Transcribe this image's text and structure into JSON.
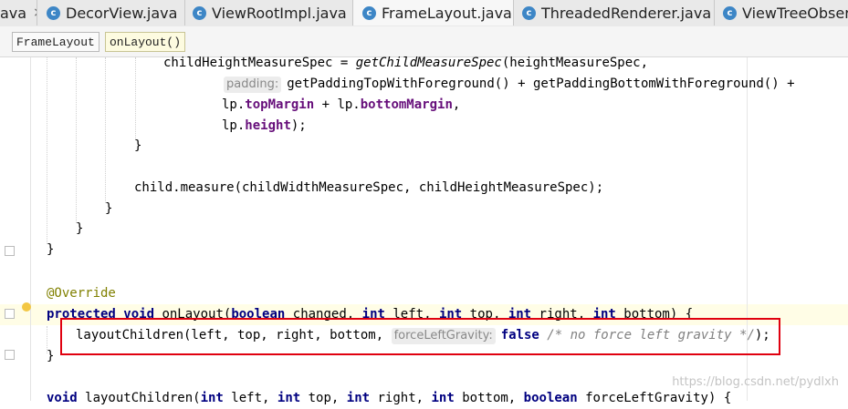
{
  "tabs": [
    {
      "label": "ava",
      "active": false,
      "icon": "none"
    },
    {
      "label": "DecorView.java",
      "active": false,
      "icon": "class-icon"
    },
    {
      "label": "ViewRootImpl.java",
      "active": false,
      "icon": "class-icon"
    },
    {
      "label": "FrameLayout.java",
      "active": true,
      "icon": "class-icon"
    },
    {
      "label": "ThreadedRenderer.java",
      "active": false,
      "icon": "class-icon"
    },
    {
      "label": "ViewTreeObserv",
      "active": false,
      "icon": "class-icon"
    }
  ],
  "class_icon_letter": "c",
  "close_glyph": "×",
  "breadcrumbs": {
    "class": "FrameLayout",
    "method": "onLayout()"
  },
  "code": {
    "l1": {
      "a": "childHeightMeasureSpec = ",
      "b": "getChildMeasureSpec",
      "c": "(heightMeasureSpec,"
    },
    "l2": {
      "hint": "padding:",
      "a": "getPaddingTopWithForeground() + getPaddingBottomWithForeground() +"
    },
    "l3": {
      "a": "lp.",
      "b": "topMargin",
      "c": " + lp.",
      "d": "bottomMargin",
      "e": ","
    },
    "l4": {
      "a": "lp.",
      "b": "height",
      "c": ");"
    },
    "l5": "}",
    "l6": "child.measure(childWidthMeasureSpec, childHeightMeasureSpec);",
    "l7": "}",
    "l8": "}",
    "l9": "}",
    "l10": "@Override",
    "l11": {
      "kw1": "protected void",
      "name": "onLayout",
      "p1": "(",
      "kw2": "boolean",
      "p2": " changed, ",
      "kw3": "int",
      "p3": " left, ",
      "kw4": "int",
      "p4": " top, ",
      "kw5": "int",
      "p5": " right, ",
      "kw6": "int",
      "p6": " bottom) {"
    },
    "l12": {
      "a": "layoutChildren(left, top, right, bottom,",
      "hint": "forceLeftGravity:",
      "kw": "false",
      "cmt": "/* no force left gravity */",
      "end": ");"
    },
    "l13": "}",
    "l14": {
      "kw1": "void",
      "a": " layoutChildren(",
      "kw2": "int",
      "b": " left, ",
      "kw3": "int",
      "c": " top, ",
      "kw4": "int",
      "d": " right, ",
      "kw5": "int",
      "e": " bottom, ",
      "kw6": "boolean",
      "f": " forceLeftGravity) {"
    }
  },
  "watermark": "https://blog.csdn.net/pydlxh",
  "colors": {
    "keyword": "#000080",
    "field": "#660e7a",
    "annotation": "#808000",
    "highlight_box": "#e0000f",
    "caret_row": "#fffde6"
  }
}
